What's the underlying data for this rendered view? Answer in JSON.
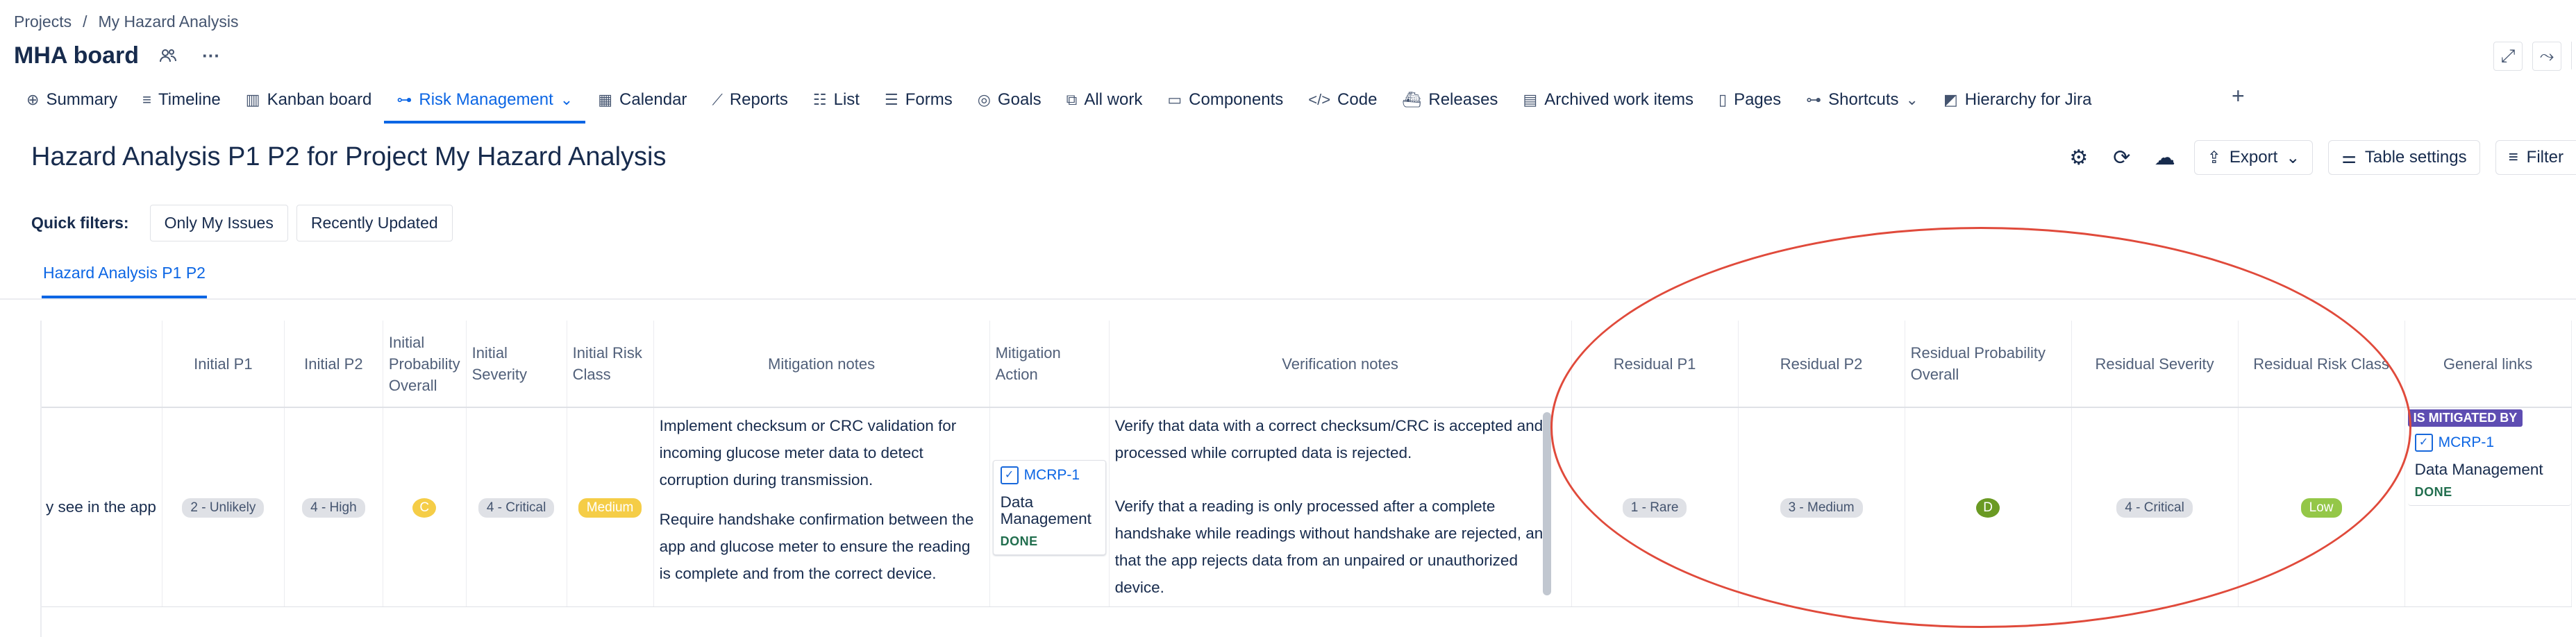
{
  "breadcrumb": {
    "projects": "Projects",
    "sep": "/",
    "current": "My Hazard Analysis"
  },
  "project": {
    "title": "MHA board",
    "more": "···"
  },
  "tabs": [
    {
      "label": "Summary",
      "icon": "globe-icon",
      "glyph": "⊕"
    },
    {
      "label": "Timeline",
      "icon": "timeline-icon",
      "glyph": "≡"
    },
    {
      "label": "Kanban board",
      "icon": "board-icon",
      "glyph": "▥"
    },
    {
      "label": "Risk Management",
      "icon": "link-icon",
      "glyph": "⊶",
      "active": true,
      "chevron": "⌄"
    },
    {
      "label": "Calendar",
      "icon": "calendar-icon",
      "glyph": "▦"
    },
    {
      "label": "Reports",
      "icon": "chart-icon",
      "glyph": "⟋"
    },
    {
      "label": "List",
      "icon": "list-icon",
      "glyph": "☷"
    },
    {
      "label": "Forms",
      "icon": "forms-icon",
      "glyph": "☰"
    },
    {
      "label": "Goals",
      "icon": "goals-icon",
      "glyph": "◎"
    },
    {
      "label": "All work",
      "icon": "all-work-icon",
      "glyph": "⧉"
    },
    {
      "label": "Components",
      "icon": "components-icon",
      "glyph": "▭"
    },
    {
      "label": "Code",
      "icon": "code-icon",
      "glyph": "</>"
    },
    {
      "label": "Releases",
      "icon": "releases-icon",
      "glyph": "⛴"
    },
    {
      "label": "Archived work items",
      "icon": "archive-icon",
      "glyph": "▤"
    },
    {
      "label": "Pages",
      "icon": "pages-icon",
      "glyph": "▯"
    },
    {
      "label": "Shortcuts",
      "icon": "shortcut-icon",
      "glyph": "⊶",
      "chevron": "⌄"
    },
    {
      "label": "Hierarchy for Jira",
      "icon": "hierarchy-app-icon",
      "glyph": "◩"
    }
  ],
  "page_title": "Hazard Analysis P1 P2 for Project My Hazard Analysis",
  "toolbar": {
    "export": "Export",
    "table_settings": "Table settings",
    "filter": "Filter"
  },
  "quick_filters": {
    "label": "Quick filters:",
    "items": [
      "Only My Issues",
      "Recently Updated"
    ]
  },
  "subtab": "Hazard Analysis P1 P2",
  "columns": {
    "initial_p1": "Initial P1",
    "initial_p2": "Initial P2",
    "initial_prob": "Initial Probability Overall",
    "initial_sev": "Initial Severity",
    "initial_risk": "Initial Risk Class",
    "mitigation_notes": "Mitigation notes",
    "mitigation_action": "Mitigation Action",
    "verification_notes": "Verification notes",
    "residual_p1": "Residual P1",
    "residual_p2": "Residual P2",
    "residual_prob": "Residual Probability Overall",
    "residual_sev": "Residual Severity",
    "residual_risk": "Residual Risk Class",
    "general_links": "General links"
  },
  "row": {
    "first": "y see in the app",
    "initial_p1": "2 - Unlikely",
    "initial_p2": "4 - High",
    "initial_prob": "C",
    "initial_sev": "4 - Critical",
    "initial_risk": "Medium",
    "mitigation_p1": "Implement checksum or CRC validation for incoming glucose meter data to detect corruption during transmission.",
    "mitigation_p2": "Require handshake confirmation between the app and glucose meter to ensure the reading is complete and from the correct device.",
    "action": {
      "key": "MCRP-1",
      "summary": "Data Management",
      "status": "DONE"
    },
    "verification_p1": "Verify that data with a correct checksum/CRC is accepted and processed while corrupted data is rejected.",
    "verification_p2": "Verify that a reading is only processed after a complete handshake while readings without handshake are rejected, and that the app rejects data from an unpaired or unauthorized device.",
    "residual_p1": "1 - Rare",
    "residual_p2": "3 - Medium",
    "residual_prob": "D",
    "residual_sev": "4 - Critical",
    "residual_risk": "Low",
    "link": {
      "type": "IS MITIGATED BY",
      "key": "MCRP-1",
      "summary": "Data Management",
      "status": "DONE"
    }
  },
  "colors": {
    "accent": "#0c66e4",
    "annotation": "#e04a3b",
    "link_label": "#5e4db2"
  }
}
